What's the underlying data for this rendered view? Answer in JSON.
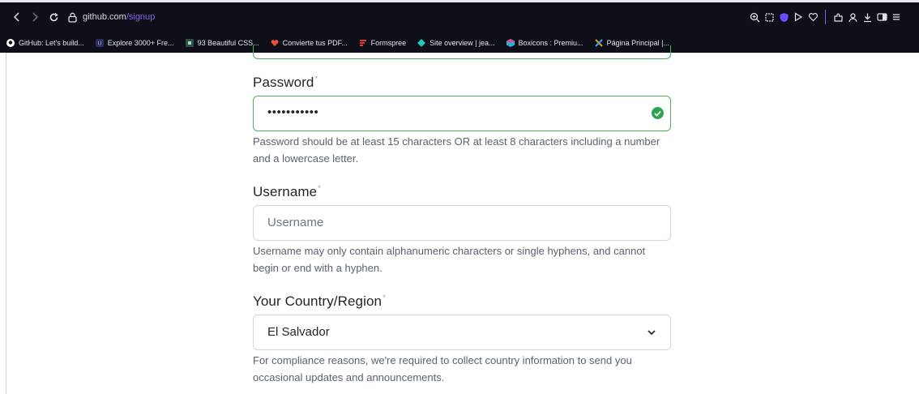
{
  "browser": {
    "url_host": "github.com",
    "url_path": "/signup",
    "bookmarks": [
      {
        "label": "GitHub: Let's build...",
        "color": "#ffffff"
      },
      {
        "label": "Explore 3000+ Fre...",
        "color": "#7b8cff"
      },
      {
        "label": "93 Beautiful CSS...",
        "color": "#3aa57a"
      },
      {
        "label": "Convierte tus PDF...",
        "color": "#e8503a"
      },
      {
        "label": "Formspree",
        "color": "#e23a3a"
      },
      {
        "label": "Site overview | jea...",
        "color": "#1ec4b4"
      },
      {
        "label": "Boxicons : Premiu...",
        "color": "#27b0d8"
      },
      {
        "label": "Página Principal |...",
        "color": "#d89c2a"
      }
    ]
  },
  "form": {
    "password": {
      "label": "Password",
      "required_mark": "*",
      "value": "•••••••••••",
      "hint": "Password should be at least 15 characters OR at least 8 characters including a number and a lowercase letter."
    },
    "username": {
      "label": "Username",
      "required_mark": "*",
      "placeholder": "Username",
      "hint": "Username may only contain alphanumeric characters or single hyphens, and cannot begin or end with a hyphen."
    },
    "country": {
      "label": "Your Country/Region",
      "required_mark": "*",
      "selected": "El Salvador",
      "hint": "For compliance reasons, we're required to collect country information to send you occasional updates and announcements."
    }
  },
  "colors": {
    "valid_border": "#4bb35a",
    "check_green": "#2da44e",
    "url_path": "#8a63e8"
  }
}
